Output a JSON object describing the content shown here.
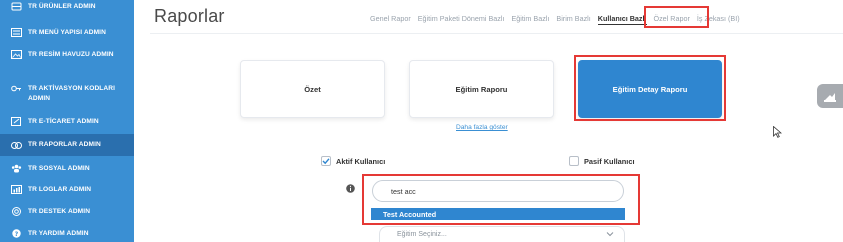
{
  "sidebar": {
    "items": [
      {
        "label": "TR ÜRÜNLER ADMIN",
        "icon": "database-icon"
      },
      {
        "label": "TR MENÜ YAPISI ADMIN",
        "icon": "menu-icon"
      },
      {
        "label": "TR RESİM HAVUZU ADMIN",
        "icon": "image-icon"
      },
      {
        "label": "TR AKTİVASYON KODLARI ADMIN",
        "icon": "key-icon"
      },
      {
        "label": "TR E-TİCARET ADMIN",
        "icon": "cart-icon"
      },
      {
        "label": "TR RAPORLAR ADMIN",
        "icon": "reports-icon"
      },
      {
        "label": "TR SOSYAL ADMIN",
        "icon": "users-icon"
      },
      {
        "label": "TR LOGLAR ADMIN",
        "icon": "logs-icon"
      },
      {
        "label": "TR DESTEK ADMIN",
        "icon": "support-icon"
      },
      {
        "label": "TR YARDIM ADMIN",
        "icon": "help-icon"
      }
    ]
  },
  "header": {
    "title": "Raporlar",
    "tabs": [
      "Genel Rapor",
      "Eğitim Paketi Dönemi Bazlı",
      "Eğitim Bazlı",
      "Birim Bazlı",
      "Kullanıcı Bazlı",
      "Özel Rapor",
      "İş Zekası (BI)"
    ],
    "active_tab": "Kullanıcı Bazlı"
  },
  "cards": {
    "ozet": "Özet",
    "egitim_raporu": "Eğitim Raporu",
    "egitim_detay_raporu": "Eğitim Detay Raporu"
  },
  "more_link": "Daha fazla göster",
  "filters": {
    "aktif_label": "Aktif Kullanıcı",
    "aktif_checked": true,
    "pasif_label": "Pasif Kullanıcı",
    "pasif_checked": false
  },
  "search": {
    "value": "test acc",
    "suggestion": "Test Accounted"
  },
  "egitim_select": {
    "placeholder": "Eğitim Seçiniz..."
  },
  "colors": {
    "sidebar": "#3a8fd3",
    "sidebar_active": "#2a6fae",
    "accent": "#2f86d0",
    "highlight_box": "#e53935"
  }
}
